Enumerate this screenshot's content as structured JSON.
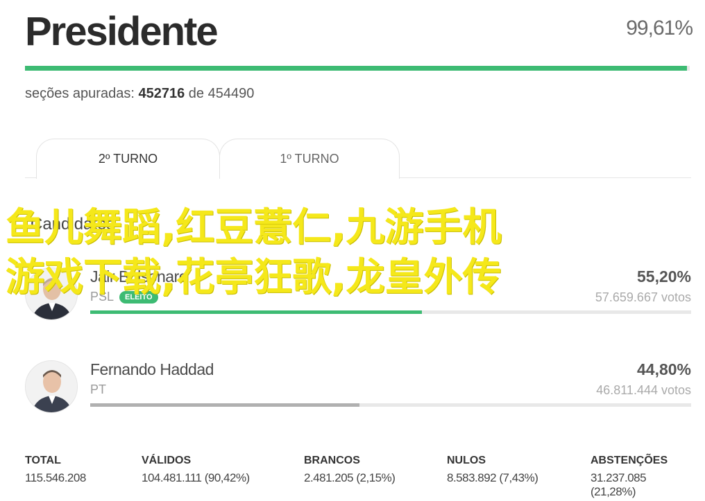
{
  "header": {
    "title": "Presidente",
    "percent": "99,61%",
    "progress": 0.9961,
    "sections_label": "seções apuradas:",
    "sections_counted": "452716",
    "sections_of": "de",
    "sections_total": "454490"
  },
  "tabs": [
    {
      "label": "2º TURNO",
      "active": true
    },
    {
      "label": "1º TURNO",
      "active": false
    }
  ],
  "overlay": {
    "line1": "鱼儿舞蹈,红豆薏仁,九游手机",
    "line2": "游戏下载,花亭狂歌,龙皇外传"
  },
  "section_title": "Candidatos",
  "candidates": [
    {
      "name": "Jair Bolsonaro",
      "party": "PSL",
      "badge": "ELEITO",
      "percent": "55,20%",
      "votes": "57.659.667 votos",
      "share": 0.552,
      "color": "#3dbb73"
    },
    {
      "name": "Fernando Haddad",
      "party": "PT",
      "badge": "",
      "percent": "44,80%",
      "votes": "46.811.444 votos",
      "share": 0.448,
      "color": "#b0b0b0"
    }
  ],
  "totals": [
    {
      "label": "TOTAL",
      "value": "115.546.208"
    },
    {
      "label": "VÁLIDOS",
      "value": "104.481.111 (90,42%)"
    },
    {
      "label": "BRANCOS",
      "value": "2.481.205 (2,15%)"
    },
    {
      "label": "NULOS",
      "value": "8.583.892 (7,43%)"
    },
    {
      "label": "ABSTENÇÕES",
      "value": "31.237.085 (21,28%)"
    }
  ],
  "colors": {
    "accent": "#3dbb73",
    "overlay_text": "#f5e81a"
  }
}
